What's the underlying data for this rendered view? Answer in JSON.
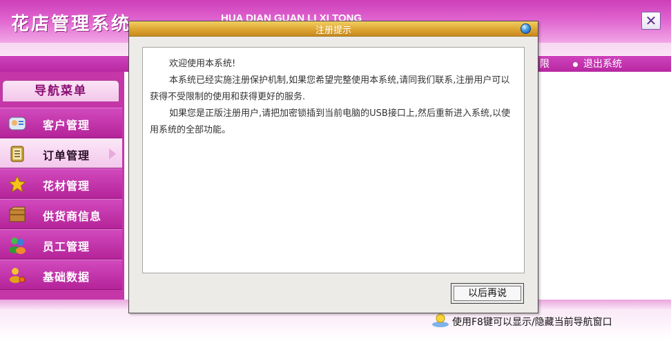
{
  "header": {
    "title": "花店管理系统",
    "subtitle": "HUA DIAN GUAN LI XI TONG",
    "close_symbol": "✕"
  },
  "menubar": {
    "items": [
      {
        "label": "限"
      },
      {
        "label": "退出系统"
      }
    ]
  },
  "sidebar": {
    "header": "导航菜单",
    "items": [
      {
        "label": "客户管理",
        "icon": "contacts-icon"
      },
      {
        "label": "订单管理",
        "icon": "notepad-icon",
        "active": true
      },
      {
        "label": "花材管理",
        "icon": "star-icon"
      },
      {
        "label": "供货商信息",
        "icon": "box-icon"
      },
      {
        "label": "员工管理",
        "icon": "users-icon"
      },
      {
        "label": "基础数据",
        "icon": "user-settings-icon"
      }
    ]
  },
  "dialog": {
    "title": "注册提示",
    "paragraphs": [
      "欢迎使用本系统!",
      "本系统已经实施注册保护机制,如果您希望完整使用本系统,请同我们联系,注册用户可以获得不受限制的使用和获得更好的服务.",
      "如果您是正版注册用户,请把加密锁插到当前电脑的USB接口上,然后重新进入系统,以使用系统的全部功能。"
    ],
    "button_label": "以后再说"
  },
  "footer": {
    "hint": "使用F8键可以显示/隐藏当前导航窗口"
  },
  "colors": {
    "header": "#cc3fb8",
    "menubar": "#b7269f",
    "sidebar": "#c537a8",
    "dialog_titlebar": "#dda531"
  }
}
